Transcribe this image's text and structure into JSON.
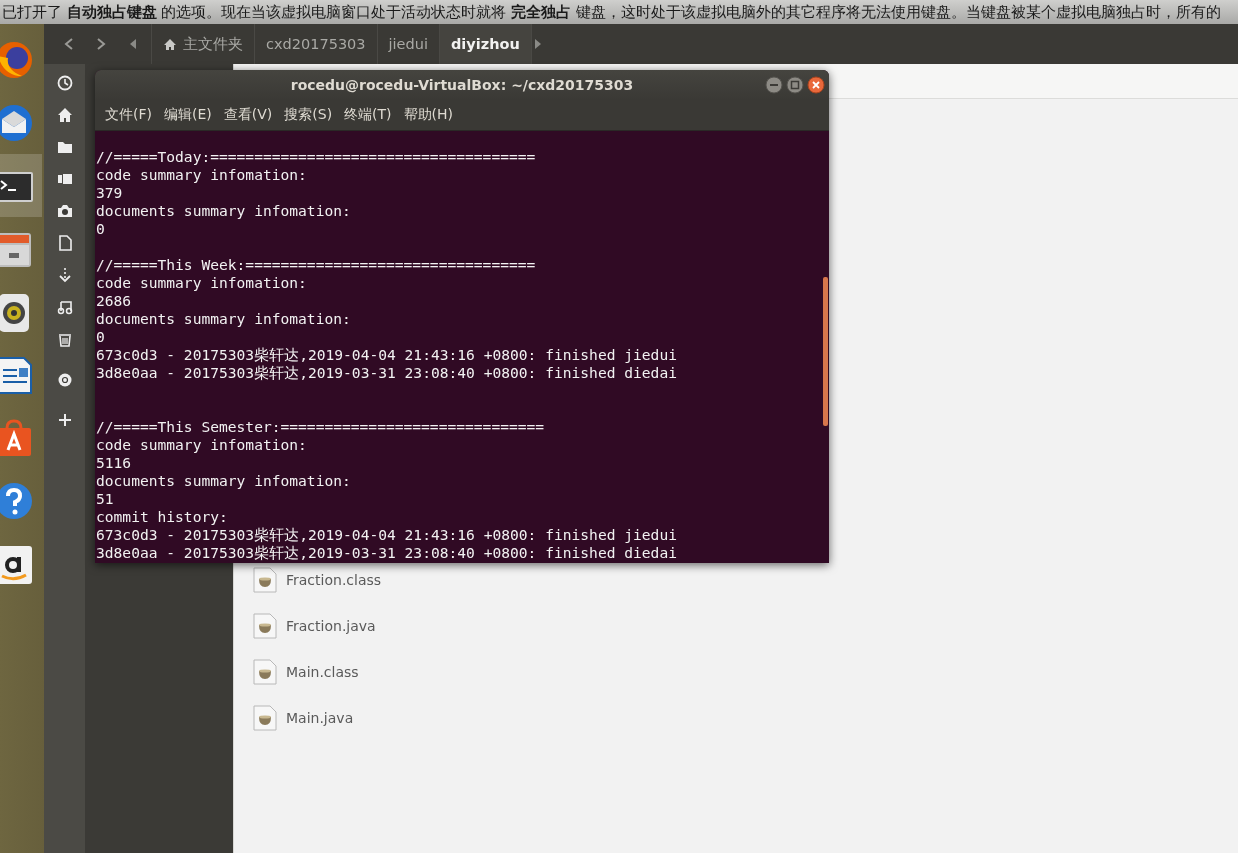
{
  "notification": {
    "text": "已打开了 **自动独占键盘** 的选项。现在当该虚拟电脑窗口处于活动状态时就将 **完全独占** 键盘，这时处于该虚拟电脑外的其它程序将无法使用键盘。当键盘被某个虚拟电脑独占时，所有的"
  },
  "dock": {
    "items": [
      {
        "kind": "browser",
        "selected": false
      },
      {
        "kind": "mail",
        "selected": false
      },
      {
        "kind": "terminal",
        "selected": true
      },
      {
        "kind": "cabinet",
        "selected": false
      },
      {
        "kind": "speaker",
        "selected": false
      },
      {
        "kind": "writer",
        "selected": false
      },
      {
        "kind": "bag",
        "selected": false
      },
      {
        "kind": "help",
        "selected": false
      },
      {
        "kind": "tile",
        "selected": false
      }
    ]
  },
  "file_manager": {
    "path_bar": [
      {
        "label": "主文件夹",
        "kind": "home",
        "selected": false
      },
      {
        "label": "cxd20175303",
        "kind": "folder",
        "selected": false
      },
      {
        "label": "jiedui",
        "kind": "folder",
        "selected": false
      },
      {
        "label": "diyizhou",
        "kind": "folder",
        "selected": true
      }
    ],
    "places": [
      {
        "kind": "recent"
      },
      {
        "kind": "home"
      },
      {
        "kind": "folder"
      },
      {
        "kind": "video"
      },
      {
        "kind": "camera"
      },
      {
        "kind": "document"
      },
      {
        "kind": "download"
      },
      {
        "kind": "music"
      },
      {
        "kind": "trash"
      },
      {
        "kind": "disc"
      },
      {
        "kind": "add"
      }
    ],
    "files": [
      {
        "name": "Fraction.class"
      },
      {
        "name": "Fraction.java"
      },
      {
        "name": "Main.class"
      },
      {
        "name": "Main.java"
      }
    ]
  },
  "terminal": {
    "title": "rocedu@rocedu-VirtualBox: ~/cxd20175303",
    "menu": [
      "文件(F)",
      "编辑(E)",
      "查看(V)",
      "搜索(S)",
      "终端(T)",
      "帮助(H)"
    ],
    "blocks": [
      {
        "lines": [
          "//=====Today:=====================================",
          "code summary infomation:",
          "379",
          "documents summary infomation:",
          "0"
        ]
      },
      {
        "lines": [
          "//=====This Week:=================================",
          "code summary infomation:",
          "2686",
          "documents summary infomation:",
          "0",
          "673c0d3 - 20175303柴轩达,2019-04-04 21:43:16 +0800: finished jiedui",
          "3d8e0aa - 20175303柴轩达,2019-03-31 23:08:40 +0800: finished diedai"
        ]
      },
      {
        "lines": [
          "//=====This Semester:==============================",
          "code summary infomation:",
          "5116",
          "documents summary infomation:",
          "51",
          "commit history:",
          "673c0d3 - 20175303柴轩达,2019-04-04 21:43:16 +0800: finished jiedui",
          "3d8e0aa - 20175303柴轩达,2019-03-31 23:08:40 +0800: finished diedai"
        ]
      }
    ]
  }
}
